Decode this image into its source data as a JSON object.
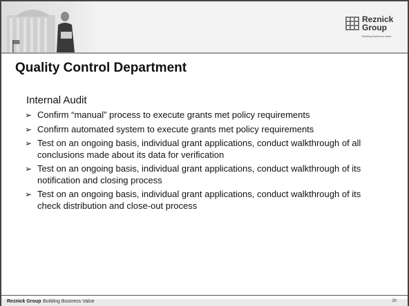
{
  "header": {
    "logo_name_line1": "Reznick",
    "logo_name_line2": "Group",
    "logo_tagline": "Building Business Value"
  },
  "title": "Quality Control Department",
  "section_heading": "Internal Audit",
  "bullets": [
    {
      "icon": "arrow-bullet-icon",
      "text": "Confirm “manual” process to execute grants met policy requirements"
    },
    {
      "icon": "arrow-bullet-icon",
      "text": "Confirm automated system to execute grants met policy requirements"
    },
    {
      "icon": "arrow-bullet-icon",
      "text": "Test on an ongoing basis, individual grant applications, conduct walkthrough of all conclusions made about its data for verification"
    },
    {
      "icon": "arrow-bullet-icon",
      "text": "Test on an ongoing basis, individual grant applications, conduct walkthrough of its notification and closing process"
    },
    {
      "icon": "arrow-bullet-icon",
      "text": "Test on an ongoing basis, individual grant applications, conduct walkthrough of its check distribution and close-out process"
    }
  ],
  "footer": {
    "brand": "Reznick Group",
    "tagline": "Building Business Value",
    "page_number": "30"
  },
  "colors": {
    "text": "#111111",
    "header_band": "#f3f3f3",
    "divider": "#9a9a9a"
  }
}
